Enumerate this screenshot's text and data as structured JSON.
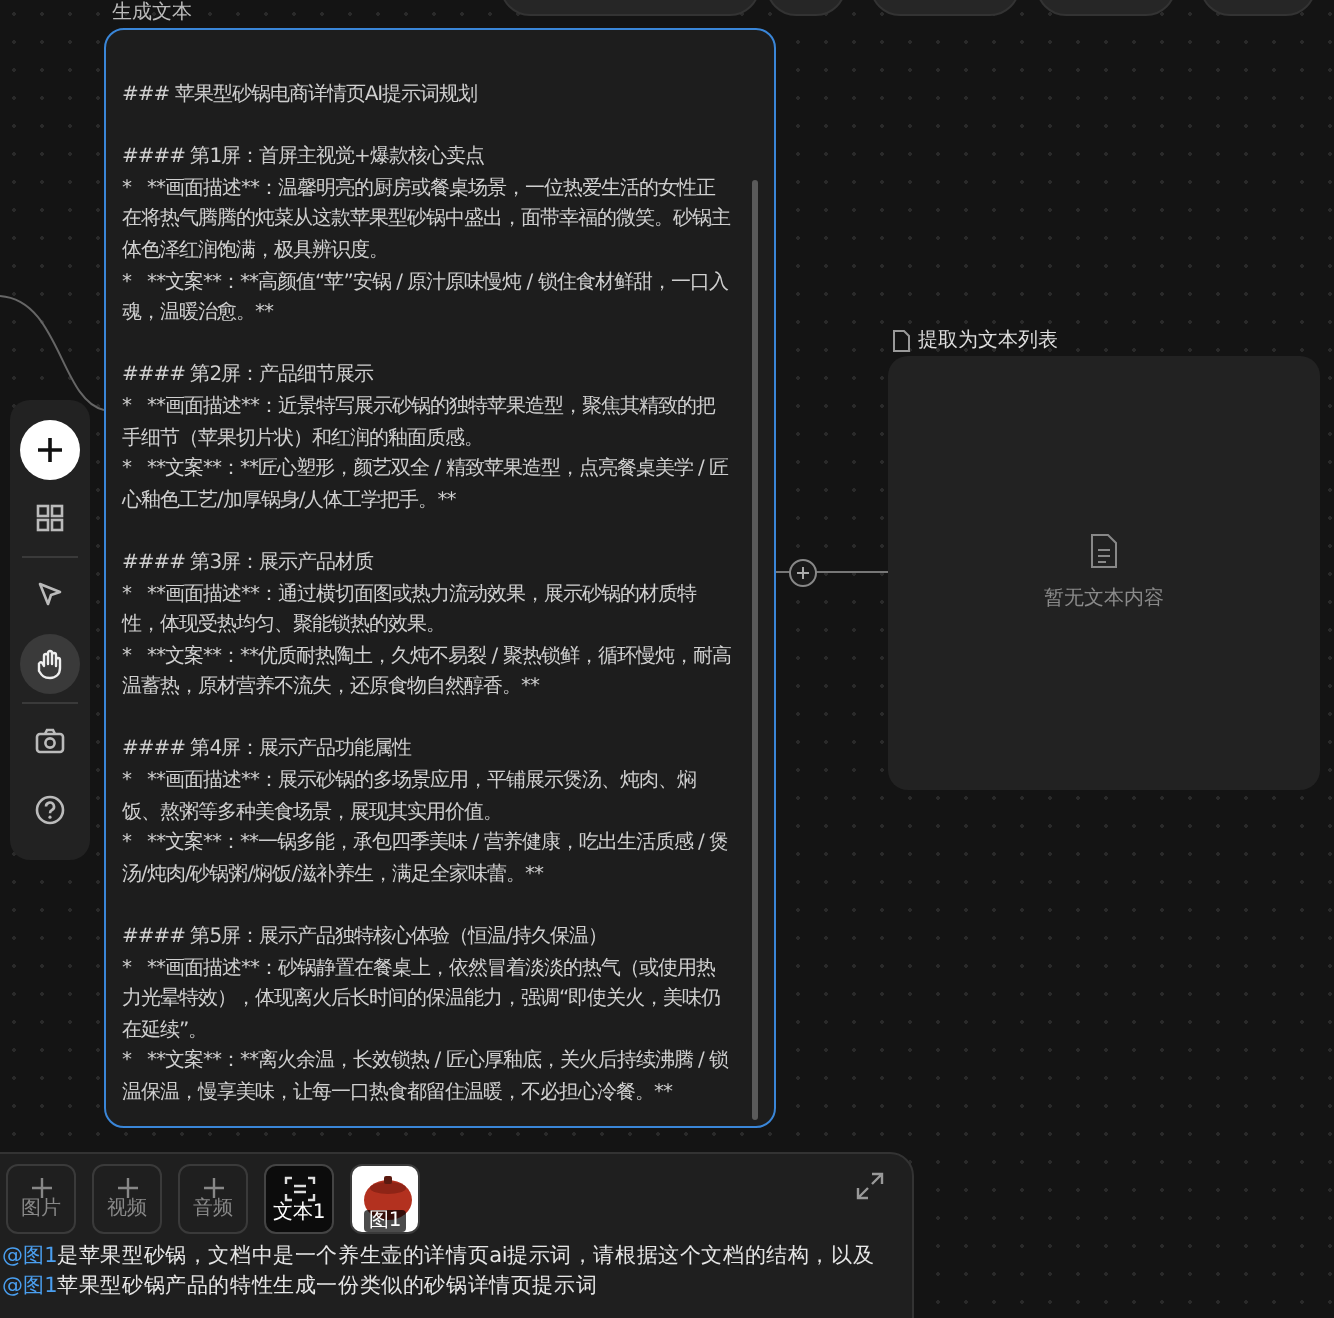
{
  "text_node": {
    "title": "生成文本",
    "selected": true,
    "heading": "### 苹果型砂锅电商详情页AI提示词规划",
    "sections": [
      {
        "heading": "#### 第1屏：首屏主视觉+爆款核心卖点",
        "bullets": [
          "*   **画面描述**：温馨明亮的厨房或餐桌场景，一位热爱生活的女性正在将热气腾腾的炖菜从这款苹果型砂锅中盛出，面带幸福的微笑。砂锅主体色泽红润饱满，极具辨识度。",
          "*   **文案**：**高颜值“苹”安锅 / 原汁原味慢炖 / 锁住食材鲜甜，一口入魂，温暖治愈。**"
        ]
      },
      {
        "heading": "#### 第2屏：产品细节展示",
        "bullets": [
          "*   **画面描述**：近景特写展示砂锅的独特苹果造型，聚焦其精致的把手细节（苹果切片状）和红润的釉面质感。",
          "*   **文案**：**匠心塑形，颜艺双全 / 精致苹果造型，点亮餐桌美学 / 匠心釉色工艺/加厚锅身/人体工学把手。**"
        ]
      },
      {
        "heading": "#### 第3屏：展示产品材质",
        "bullets": [
          "*   **画面描述**：通过横切面图或热力流动效果，展示砂锅的材质特性，体现受热均匀、聚能锁热的效果。",
          "*   **文案**：**优质耐热陶土，久炖不易裂 / 聚热锁鲜，循环慢炖，耐高温蓄热，原材营养不流失，还原食物自然醇香。**"
        ]
      },
      {
        "heading": "#### 第4屏：展示产品功能属性",
        "bullets": [
          "*   **画面描述**：展示砂锅的多场景应用，平铺展示煲汤、炖肉、焖饭、熬粥等多种美食场景，展现其实用价值。",
          "*   **文案**：**一锅多能，承包四季美味 / 营养健康，吃出生活质感 / 煲汤/炖肉/砂锅粥/焖饭/滋补养生，满足全家味蕾。**"
        ]
      },
      {
        "heading": "#### 第5屏：展示产品独特核心体验（恒温/持久保温）",
        "bullets": [
          "*   **画面描述**：砂锅静置在餐桌上，依然冒着淡淡的热气（或使用热力光晕特效），体现离火后长时间的保温能力，强调“即使关火，美味仍在延续”。",
          "*   **文案**：**离火余温，长效锁热 / 匠心厚釉底，关火后持续沸腾 / 锁温保温，慢享美味，让每一口热食都留住温暖，不必担心冷餐。**"
        ]
      }
    ]
  },
  "list_node": {
    "title": "提取为文本列表",
    "empty_text": "暂无文本内容"
  },
  "left_toolbar": {
    "groups": [
      {
        "tools": [
          {
            "kind": "add",
            "selected": false
          },
          {
            "kind": "grid",
            "selected": false
          }
        ]
      },
      {
        "tools": [
          {
            "kind": "select",
            "selected": false
          },
          {
            "kind": "pan",
            "selected": true
          }
        ]
      },
      {
        "tools": [
          {
            "kind": "capture",
            "selected": false
          },
          {
            "kind": "help",
            "selected": false
          }
        ]
      }
    ]
  },
  "prompt_panel": {
    "attachments": [
      {
        "kind": "add",
        "label": "图片"
      },
      {
        "kind": "add",
        "label": "视频"
      },
      {
        "kind": "add",
        "label": "音频"
      },
      {
        "kind": "text",
        "label": "文本1"
      },
      {
        "kind": "image",
        "label": "图1"
      }
    ],
    "lines": [
      [
        {
          "kind": "mention",
          "text": "@图1"
        },
        {
          "kind": "plain",
          "text": "是苹果型砂锅，文档中是一个养生壶的详情页ai提示词，请根据这个文档的结构，以及"
        }
      ],
      [
        {
          "kind": "mention",
          "text": "@图1"
        },
        {
          "kind": "plain",
          "text": "苹果型砂锅产品的特性生成一份类似的砂锅详情页提示词"
        }
      ]
    ]
  }
}
